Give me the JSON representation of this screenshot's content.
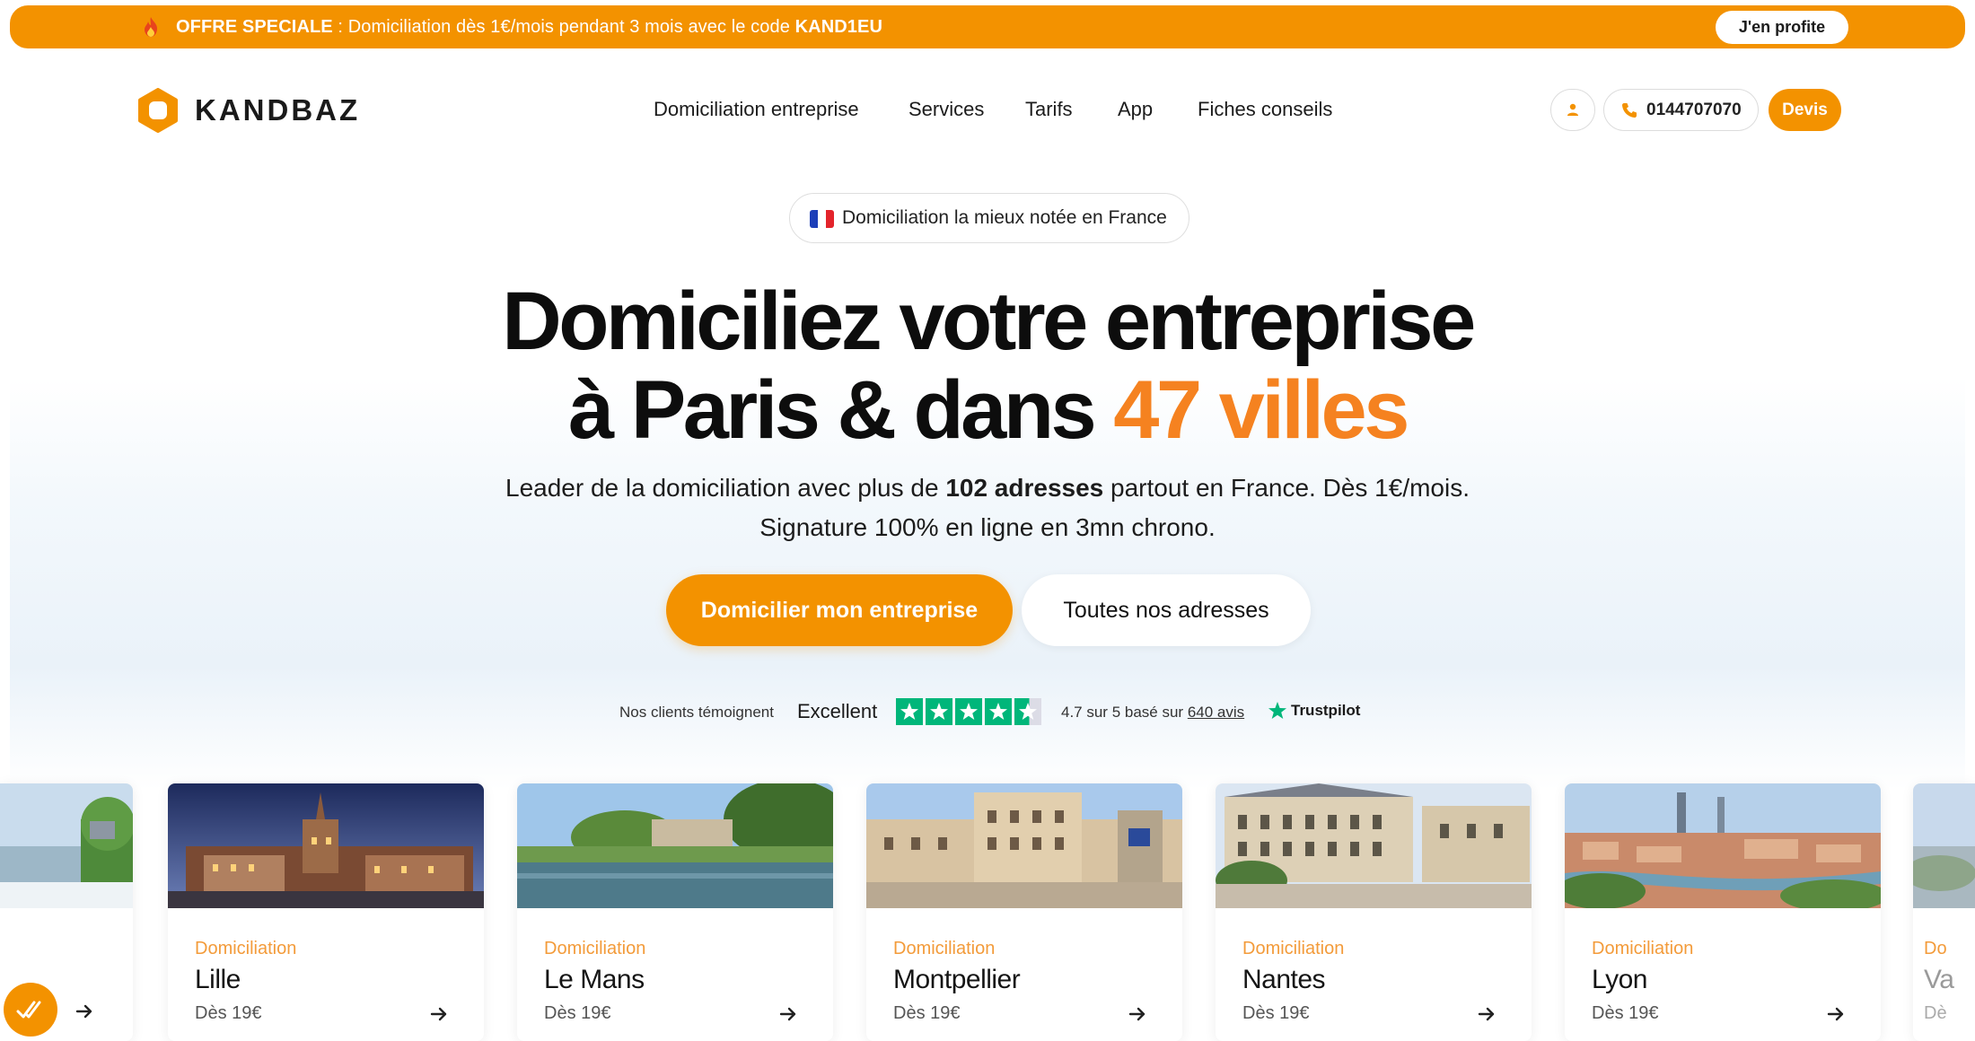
{
  "promo": {
    "prefix": "OFFRE SPECIALE",
    "text": " : Domiciliation dès 1€/mois pendant 3 mois avec le code ",
    "code": "KAND1EU",
    "cta": "J'en profite"
  },
  "header": {
    "brand": "KANDBAZ",
    "nav": [
      "Domiciliation entreprise",
      "Services",
      "Tarifs",
      "App",
      "Fiches conseils"
    ],
    "phone": "0144707070",
    "devis": "Devis"
  },
  "hero": {
    "badge": "Domiciliation la mieux notée en France",
    "title_line1": "Domiciliez votre entreprise",
    "title_line2_prefix": "à Paris & dans ",
    "title_line2_accent": "47 villes",
    "sub1_a": "Leader de la domiciliation avec plus de ",
    "sub1_b": "102 adresses",
    "sub1_c": " partout en France. Dès 1€/mois.",
    "sub2": "Signature 100% en ligne en 3mn chrono.",
    "cta_primary": "Domicilier mon entreprise",
    "cta_secondary": "Toutes nos adresses"
  },
  "trust": {
    "lead": "Nos clients témoignent",
    "rating_word": "Excellent",
    "stars": 4.5,
    "score_prefix": "4.7 sur 5 basé sur ",
    "reviews": "640 avis",
    "brand": "Trustpilot"
  },
  "cities": [
    {
      "kicker": "Domiciliation",
      "city": "Lille",
      "price": "Dès 19€"
    },
    {
      "kicker": "Domiciliation",
      "city": "Le Mans",
      "price": "Dès 19€"
    },
    {
      "kicker": "Domiciliation",
      "city": "Montpellier",
      "price": "Dès 19€"
    },
    {
      "kicker": "Domiciliation",
      "city": "Nantes",
      "price": "Dès 19€"
    },
    {
      "kicker": "Domiciliation",
      "city": "Lyon",
      "price": "Dès 19€"
    }
  ],
  "partial_right": {
    "kicker": "Do",
    "city": "Va",
    "price": "Dè"
  },
  "colors": {
    "brand": "#f39200",
    "accent_text": "#f58220",
    "trustpilot": "#00b67a"
  }
}
